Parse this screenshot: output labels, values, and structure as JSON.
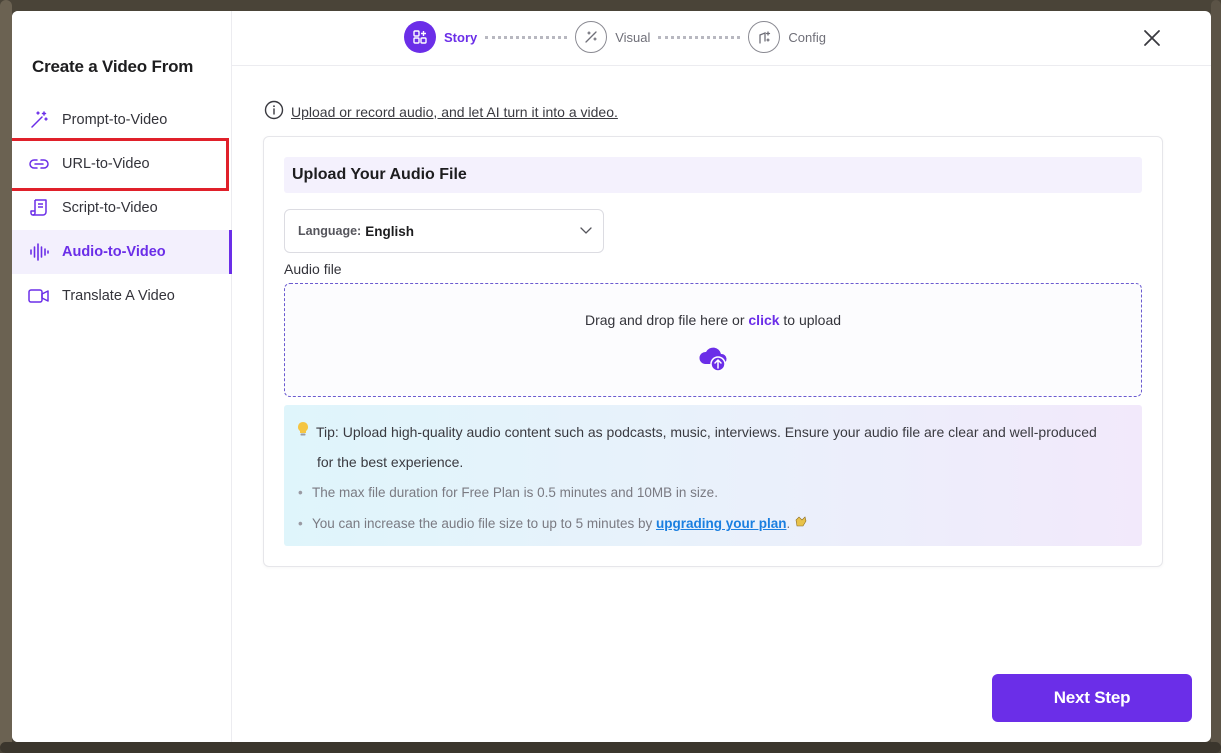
{
  "sidebar": {
    "title": "Create a Video From",
    "items": [
      {
        "label": "Prompt-to-Video",
        "icon": "magic-wand-icon"
      },
      {
        "label": "URL-to-Video",
        "icon": "link-icon"
      },
      {
        "label": "Script-to-Video",
        "icon": "script-icon"
      },
      {
        "label": "Audio-to-Video",
        "icon": "audio-waveform-icon",
        "active": true
      },
      {
        "label": "Translate A Video",
        "icon": "video-camera-icon"
      }
    ]
  },
  "steps": [
    {
      "label": "Story",
      "active": true,
      "icon": "story-icon"
    },
    {
      "label": "Visual",
      "active": false,
      "icon": "visual-brush-icon"
    },
    {
      "label": "Config",
      "active": false,
      "icon": "config-icon"
    }
  ],
  "info": {
    "text": "Upload or record audio, and let AI turn it into a video.",
    "icon": "info-icon"
  },
  "card": {
    "heading": "Upload Your Audio File",
    "language": {
      "label": "Language:",
      "value": "English"
    },
    "audio_label": "Audio file",
    "dropzone": {
      "prefix": "Drag and drop file here or ",
      "click": "click",
      "suffix": " to upload",
      "icon": "cloud-upload-icon"
    },
    "tip": {
      "icon": "lightbulb-icon",
      "main": "Tip: Upload high-quality audio content such as podcasts, music, interviews. Ensure your audio file are clear and well-produced",
      "main2": "for the best experience.",
      "bullet1": "The max file duration for Free Plan is 0.5 minutes and 10MB in size.",
      "bullet2_prefix": "You can increase the audio file size to up to 5 minutes by ",
      "bullet2_link": "upgrading your plan",
      "bullet2_suffix": ".",
      "bullet2_icon": "clapping-hands-icon"
    }
  },
  "next_button": "Next Step",
  "colors": {
    "accent": "#6b2ee8",
    "highlight": "#e0202a",
    "link": "#1a7fe0"
  }
}
